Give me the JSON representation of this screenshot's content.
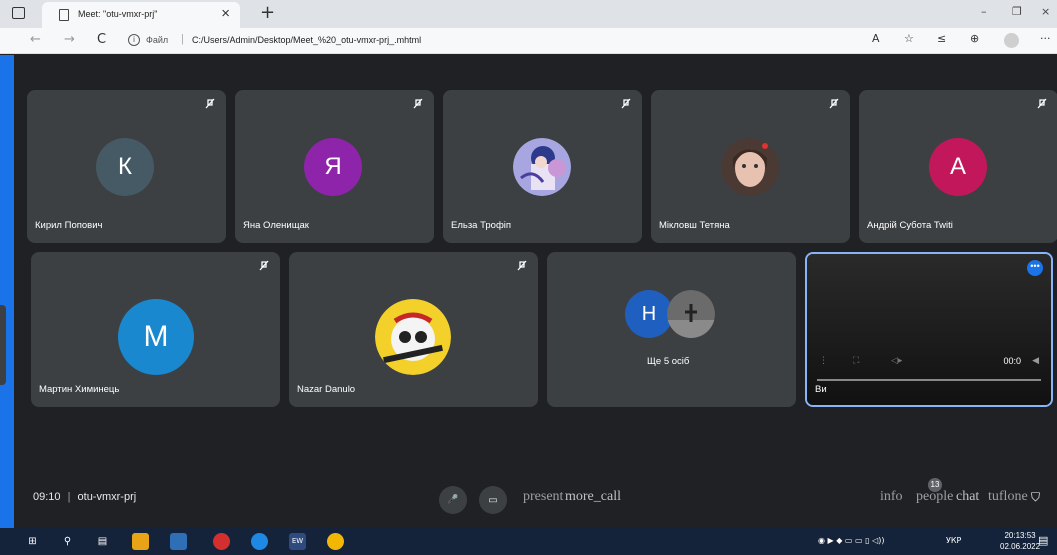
{
  "browser": {
    "tab_title": "Meet: \"otu-vmxr-prj\"",
    "tab_close": "×",
    "new_tab": "+",
    "back": "←",
    "forward": "→",
    "reload": "C",
    "info": "i",
    "file_label": "Файл",
    "url_sep": "|",
    "url": "C:/Users/Admin/Desktop/Meet_%20_otu-vmxr-prj_.mhtml",
    "window_minimize": "–",
    "window_restore": "❐",
    "window_close": "×",
    "read_aloud": "A",
    "favorite": "☆",
    "favorites": "≤",
    "collections": "⊕",
    "more": "···"
  },
  "participants": [
    {
      "name": "Кирил Попович",
      "initial": "К",
      "color": "#455a64"
    },
    {
      "name": "Яна Оленищак",
      "initial": "Я",
      "color": "#8e24aa"
    },
    {
      "name": "Ельза Трофіп",
      "photo": "anime"
    },
    {
      "name": "Мікловш Тетяна",
      "photo": "woman"
    },
    {
      "name": "Андрій Субота Twiti",
      "initial": "A",
      "color": "#c2185b"
    },
    {
      "name": "Мартин Химинець",
      "initial": "M",
      "color": "#1a88cf"
    },
    {
      "name": "Nazar Danulo",
      "photo": "skull"
    }
  ],
  "others": {
    "initial": "H",
    "color": "#1f5fbf",
    "label": "Ще 5 осіб"
  },
  "self": {
    "name": "Ви",
    "time": "00:0",
    "more": "•••"
  },
  "bottom": {
    "time": "09:10",
    "separator": "|",
    "meeting_code": "otu-vmxr-prj",
    "mic_icon": "🎤",
    "cam_icon": "▭",
    "overlay_text_1": "present",
    "overlay_text_2": "more_call",
    "right_text_1": "info",
    "right_text_2": "people",
    "right_text_3": "chat",
    "right_text_4": "tuflone",
    "participant_count": "13"
  },
  "taskbar": {
    "lang": "УКР",
    "time": "20:13:53",
    "date": "02.06.2022"
  },
  "colors": {
    "tile_bg": "#3c4043",
    "meet_bg": "#202124",
    "accent": "#1a73e8"
  }
}
